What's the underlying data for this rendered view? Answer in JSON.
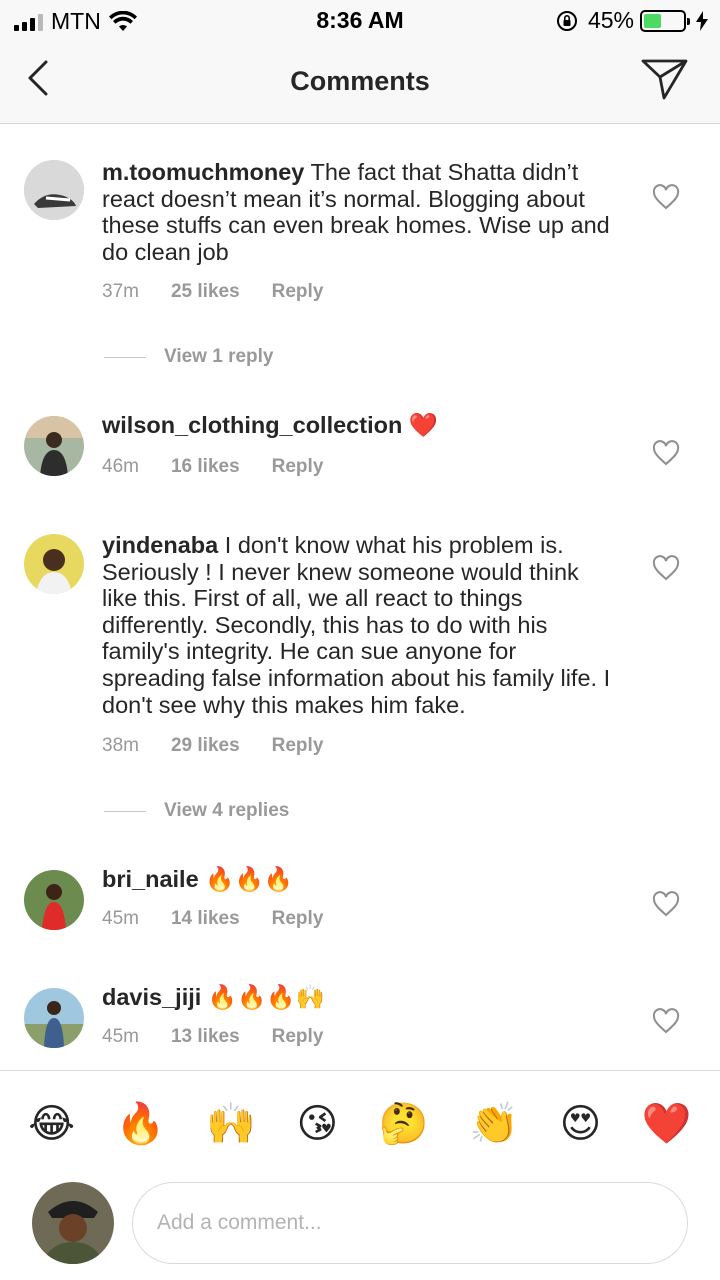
{
  "status_bar": {
    "carrier": "MTN",
    "time": "8:36 AM",
    "battery": "45%",
    "battery_level": 0.45
  },
  "header": {
    "title": "Comments"
  },
  "comments": [
    {
      "username": "m.toomuchmoney",
      "emoji": "",
      "text": "The fact that Shatta didn’t react doesn’t mean it’s normal. Blogging about these stuffs can even break homes. Wise up and do clean job",
      "time": "37m",
      "likes": "25 likes",
      "reply": "Reply"
    },
    {
      "username": "wilson_clothing_collection",
      "emoji": "❤️",
      "text": "",
      "time": "46m",
      "likes": "16 likes",
      "reply": "Reply"
    },
    {
      "username": "yindenaba",
      "emoji": "",
      "text": "I don't know what his problem is. Seriously ! I never knew someone would think like this. First of all, we all react to things differently. Secondly, this has to do with his family's integrity.  He can sue anyone for spreading false information about his family life.  I don't see why this makes him fake.",
      "time": "38m",
      "likes": "29 likes",
      "reply": "Reply"
    },
    {
      "username": "bri_naile",
      "emoji": "🔥🔥🔥",
      "text": "",
      "time": "45m",
      "likes": "14 likes",
      "reply": "Reply"
    },
    {
      "username": "davis_jiji",
      "emoji": "🔥🔥🔥🙌",
      "text": "",
      "time": "45m",
      "likes": "13 likes",
      "reply": "Reply"
    }
  ],
  "view_replies": [
    "View 1 reply",
    "View 4 replies"
  ],
  "emoji_bar": [
    "😂",
    "🔥",
    "🙌",
    "😘",
    "🤔",
    "👏",
    "😍",
    "❤️"
  ],
  "input": {
    "placeholder": "Add a comment..."
  },
  "colors": {
    "text": "#262626",
    "muted": "#999999",
    "battery": "#4cd964",
    "heart": "#ed4956"
  }
}
